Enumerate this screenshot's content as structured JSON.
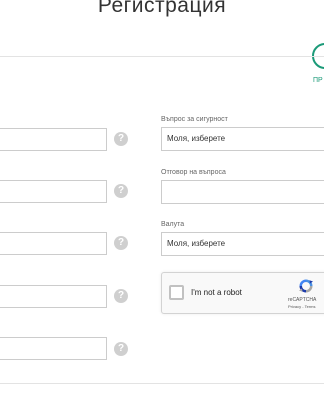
{
  "page": {
    "title": "Регистрация"
  },
  "steps": {
    "next_label": "ПР"
  },
  "form": {
    "help_symbol": "?",
    "security_question": {
      "label": "Въпрос за сигурност",
      "value": "Моля, изберете"
    },
    "security_answer": {
      "label": "Отговор на въпроса",
      "value": ""
    },
    "currency": {
      "label": "Валута",
      "value": "Моля, изберете"
    }
  },
  "recaptcha": {
    "label": "I'm not a robot",
    "brand": "reCAPTCHA",
    "links": "Privacy - Terms"
  },
  "colors": {
    "accent": "#1b9a78",
    "border": "#cccccc",
    "help_icon": "#cfcfcf",
    "recaptcha_bg": "#f9f9f9"
  },
  "icons": {
    "help": "question-circle-icon",
    "recaptcha": "recaptcha-logo-icon",
    "step": "step-circle-icon"
  }
}
